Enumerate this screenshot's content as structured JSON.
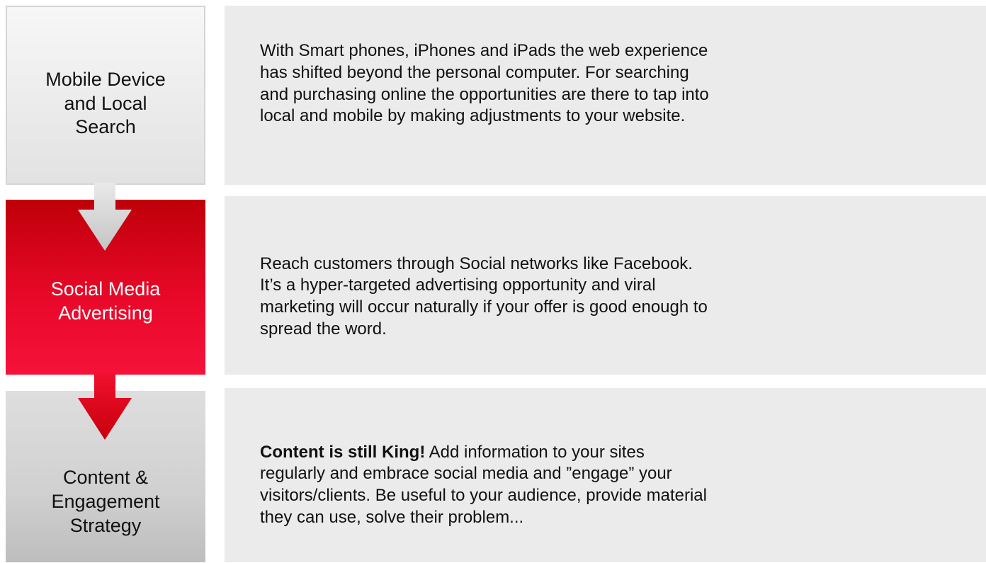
{
  "steps": [
    {
      "label": "Mobile Device\nand Local\nSearch",
      "description": "With Smart phones, iPhones and iPads the web experience has shifted beyond the personal computer. For searching and purchasing online the opportunities are there to tap into local and mobile by making adjustments to your website."
    },
    {
      "label": "Social Media\nAdvertising",
      "description": "Reach customers through Social networks like Facebook. It’s a hyper-targeted advertising opportunity and viral marketing will occur naturally if your offer is good enough to spread the word."
    },
    {
      "label": "Content &\nEngagement\nStrategy",
      "description_bold": "Content is still King!",
      "description": " Add information to your sites regularly and embrace social media and ”engage” your visitors/clients. Be useful to your audience, provide material they can use, solve their problem..."
    }
  ],
  "colors": {
    "accent_red": "#e80828",
    "panel_gray": "#ebebeb",
    "arrow_gray": "#c8c8c8"
  },
  "icons": [
    "down-arrow-icon",
    "down-arrow-icon"
  ]
}
